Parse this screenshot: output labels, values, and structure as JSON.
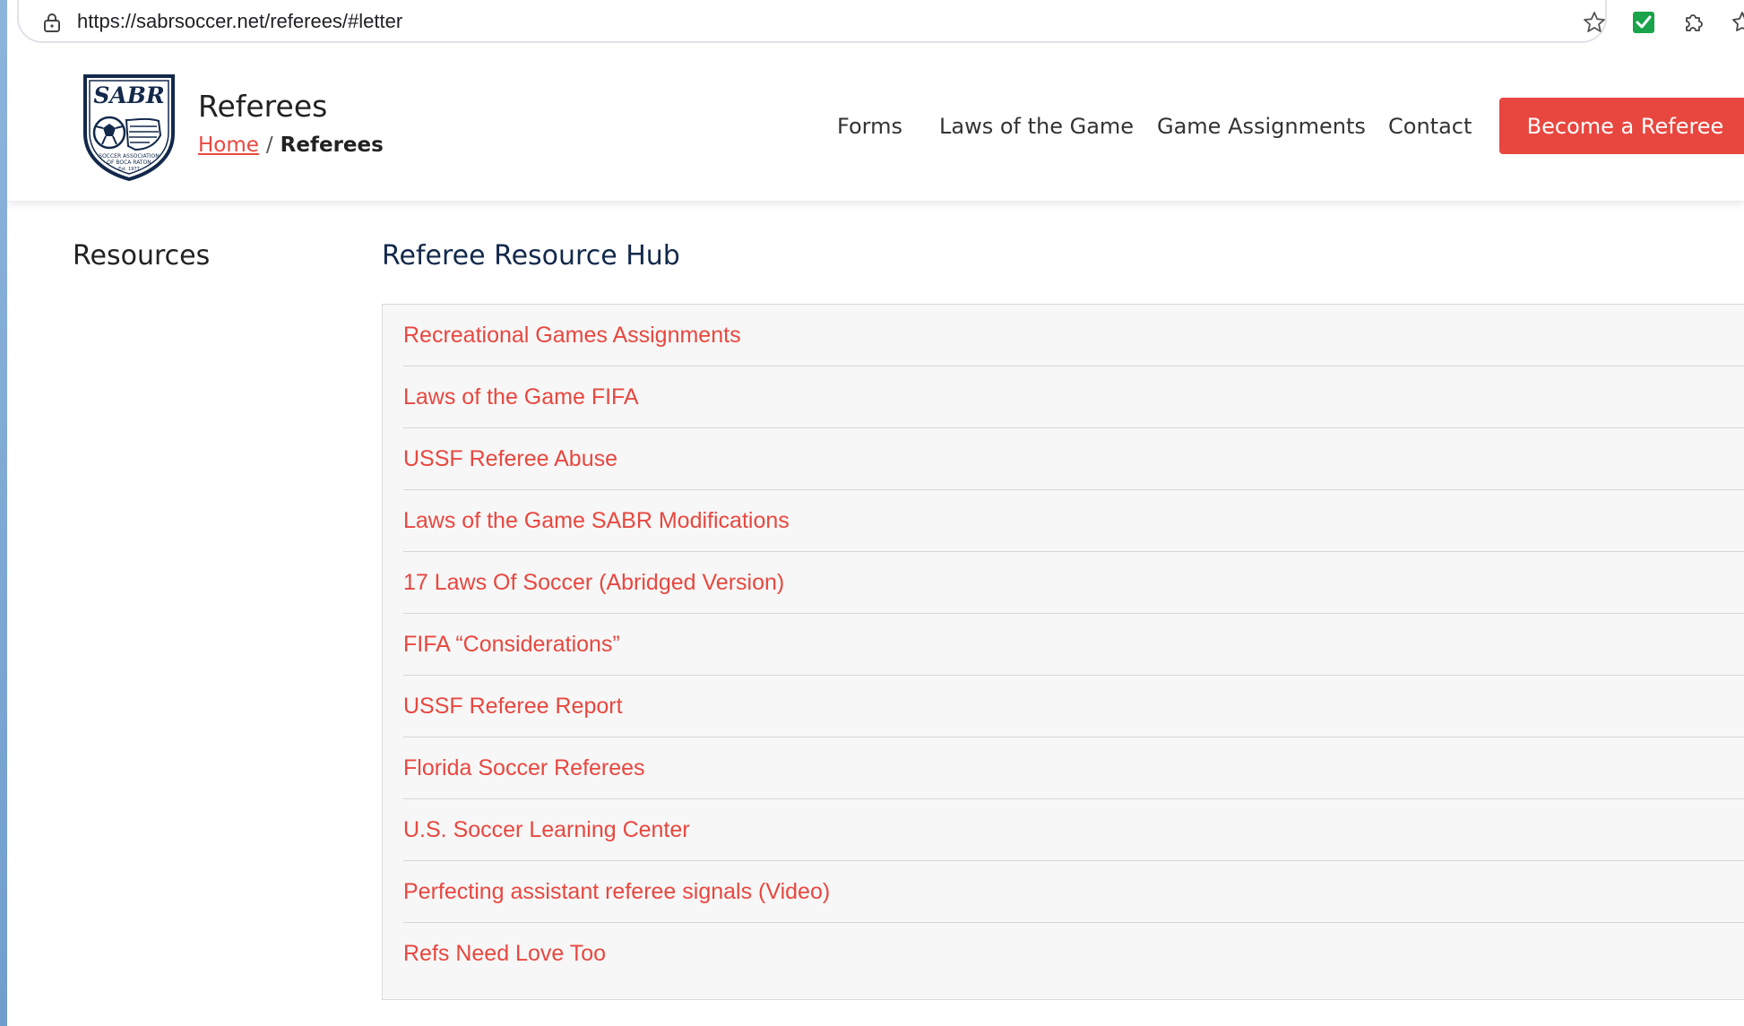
{
  "browser": {
    "url": "https://sabrsoccer.net/referees/#letter",
    "icons": [
      "lock-icon",
      "star-icon",
      "check-icon",
      "puzzle-icon",
      "bookmarks-icon"
    ]
  },
  "header": {
    "logo": {
      "initials": "SABR",
      "text_line1": "SOCCER ASSOCIATION",
      "text_line2": "OF BOCA RATON",
      "text_line3": "Est. 1977"
    },
    "page_title": "Referees",
    "breadcrumb": {
      "home": "Home",
      "separator": "/",
      "current": "Referees"
    },
    "nav": [
      {
        "label": "Forms"
      },
      {
        "label": "Laws of the Game"
      },
      {
        "label": "Game Assignments"
      },
      {
        "label": "Contact"
      }
    ],
    "cta_label": "Become a Referee"
  },
  "sidebar": {
    "title": "Resources"
  },
  "main": {
    "title": "Referee Resource Hub",
    "links": [
      {
        "label": "Recreational Games Assignments"
      },
      {
        "label": "Laws of the Game FIFA"
      },
      {
        "label": "USSF Referee Abuse"
      },
      {
        "label": "Laws of the Game SABR Modifications"
      },
      {
        "label": "17 Laws Of Soccer (Abridged Version)"
      },
      {
        "label": "FIFA “Considerations”"
      },
      {
        "label": "USSF Referee Report"
      },
      {
        "label": "Florida Soccer Referees"
      },
      {
        "label": "U.S. Soccer Learning Center"
      },
      {
        "label": "Perfecting assistant referee signals (Video)"
      },
      {
        "label": "Refs Need Love Too"
      }
    ]
  },
  "colors": {
    "accent": "#e8473f",
    "heading_navy": "#13294b",
    "panel_bg": "#f7f7f7",
    "desktop_blue": "#7aa3cf"
  }
}
